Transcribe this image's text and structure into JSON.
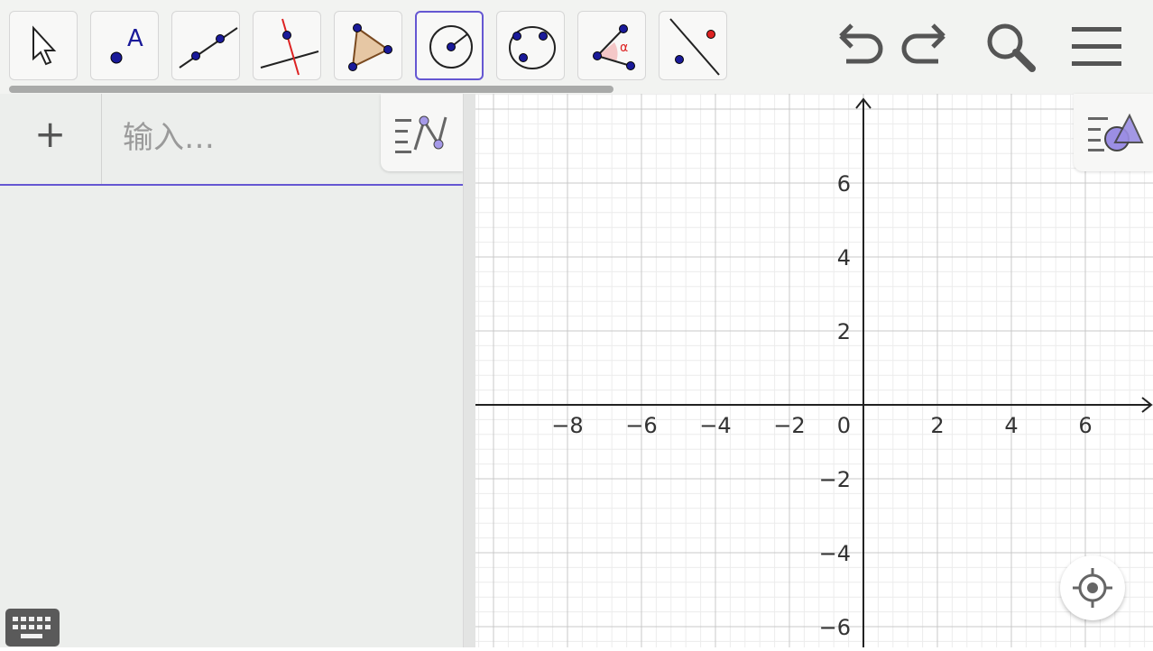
{
  "toolbar": {
    "tools": [
      {
        "name": "move",
        "icon": "arrow-cursor-icon"
      },
      {
        "name": "point",
        "icon": "point-icon",
        "label": "A"
      },
      {
        "name": "line",
        "icon": "line-through-points-icon"
      },
      {
        "name": "perpendicular-line",
        "icon": "perpendicular-line-icon"
      },
      {
        "name": "polygon",
        "icon": "polygon-icon"
      },
      {
        "name": "circle-center-point",
        "icon": "circle-center-point-icon",
        "active": true
      },
      {
        "name": "circle-three-points",
        "icon": "circle-three-points-icon"
      },
      {
        "name": "angle",
        "icon": "angle-icon",
        "label": "α"
      },
      {
        "name": "reflect",
        "icon": "reflect-about-line-icon"
      }
    ],
    "right_icons": [
      "undo-icon",
      "redo-icon",
      "search-icon",
      "menu-icon"
    ]
  },
  "algebra": {
    "add_label": "+",
    "input_placeholder": "输入…"
  },
  "graphics": {
    "x_ticks": [
      "−8",
      "−6",
      "−4",
      "−2",
      "2",
      "4",
      "6"
    ],
    "y_ticks": [
      "6",
      "4",
      "2",
      "−2",
      "−4",
      "−6"
    ],
    "origin_label": "0"
  },
  "colors": {
    "accent": "#6557d2",
    "point": "#1a1a99",
    "red": "#dd2222"
  }
}
